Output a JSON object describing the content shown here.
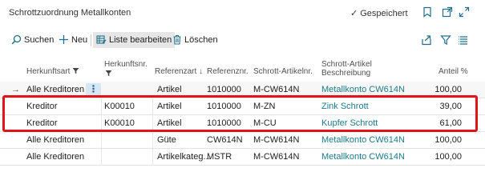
{
  "page": {
    "title": "Schrottzuordnung Metallkonten",
    "status": "Gespeichert"
  },
  "actions": {
    "search": "Suchen",
    "new": "Neu",
    "edit_list": "Liste bearbeiten",
    "delete": "Löschen"
  },
  "columns": {
    "herkunftsart": "Herkunftsart",
    "herkunftsnr": "Herkunftsnr.",
    "referenzart": "Referenzart",
    "referenznr": "Referenznr.",
    "schrott_artikelnr": "Schrott-Artikelnr.",
    "schrott_artikel_beschreibung_1": "Schrott-Artikel",
    "schrott_artikel_beschreibung_2": "Beschreibung",
    "anteil": "Anteil %"
  },
  "rows": [
    {
      "herkunftsart": "Alle Kreditoren",
      "herkunftsnr": "",
      "referenzart": "Artikel",
      "referenznr": "1010000",
      "schrott_artikelnr": "M-CW614N",
      "beschreibung": "Metallkonto CW614N",
      "anteil": "100,00"
    },
    {
      "herkunftsart": "Kreditor",
      "herkunftsnr": "K00010",
      "referenzart": "Artikel",
      "referenznr": "1010000",
      "schrott_artikelnr": "M-ZN",
      "beschreibung": "Zink Schrott",
      "anteil": "39,00"
    },
    {
      "herkunftsart": "Kreditor",
      "herkunftsnr": "K00010",
      "referenzart": "Artikel",
      "referenznr": "1010000",
      "schrott_artikelnr": "M-CU",
      "beschreibung": "Kupfer Schrott",
      "anteil": "61,00"
    },
    {
      "herkunftsart": "Alle Kreditoren",
      "herkunftsnr": "",
      "referenzart": "Güte",
      "referenznr": "CW614N",
      "schrott_artikelnr": "M-CW614N",
      "beschreibung": "Metallkonto CW614N",
      "anteil": "100,00"
    },
    {
      "herkunftsart": "Alle Kreditoren",
      "herkunftsnr": "",
      "referenzart": "Artikelkateg...",
      "referenznr": "MSTR",
      "schrott_artikelnr": "M-CW614N",
      "beschreibung": "Metallkonto CW614N",
      "anteil": "100,00"
    }
  ],
  "icons": {
    "saved": "check-icon",
    "bookmark": "bookmark-icon",
    "open_new": "open-new-window-icon",
    "expand": "expand-icon",
    "search": "search-icon",
    "new": "plus-icon",
    "edit_list": "edit-list-icon",
    "delete": "trash-icon",
    "share": "share-icon",
    "filter": "filter-icon",
    "list_view": "list-view-icon",
    "row_arrow": "arrow-right-icon",
    "row_menu": "more-options-icon"
  },
  "colors": {
    "accent": "#1f6f8b",
    "link": "#1d7a8a",
    "highlight": "#e0141b"
  }
}
